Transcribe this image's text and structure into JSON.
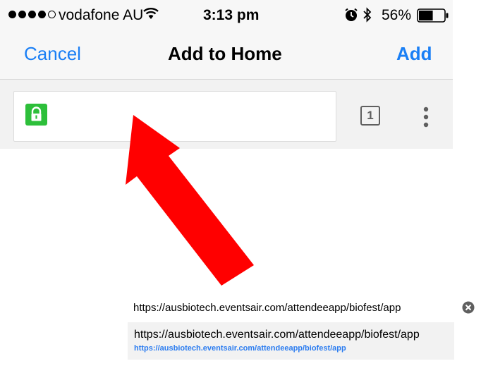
{
  "status_bar": {
    "carrier": "vodafone AU",
    "time": "3:13 pm",
    "battery": "56%",
    "signal": {
      "filled": 4,
      "total": 5
    },
    "battery_level": 0.56,
    "icons": [
      "signal-dots-icon",
      "wifi-icon",
      "alarm-icon",
      "bluetooth-icon",
      "battery-icon"
    ]
  },
  "nav": {
    "cancel_label": "Cancel",
    "title": "Add to Home",
    "add_label": "Add"
  },
  "toolbar": {
    "tab_count": "1",
    "icons": [
      "lock-icon",
      "tab-switcher-icon",
      "more-menu-icon"
    ],
    "lock_color": "#2dbf3a"
  },
  "annotation": {
    "icon": "red-arrow-icon",
    "color": "#ff0000"
  },
  "url_field": {
    "value": "https://ausbiotech.eventsair.com/attendeeapp/biofest/app",
    "clear_icon": "clear-icon"
  },
  "suggestion": {
    "title": "https://ausbiotech.eventsair.com/attendeeapp/biofest/app",
    "url": "https://ausbiotech.eventsair.com/attendeeapp/biofest/app",
    "url_color": "#2b7cf0"
  },
  "colors": {
    "accent": "#1a7ff5",
    "bar_background": "#f7f7f7"
  }
}
